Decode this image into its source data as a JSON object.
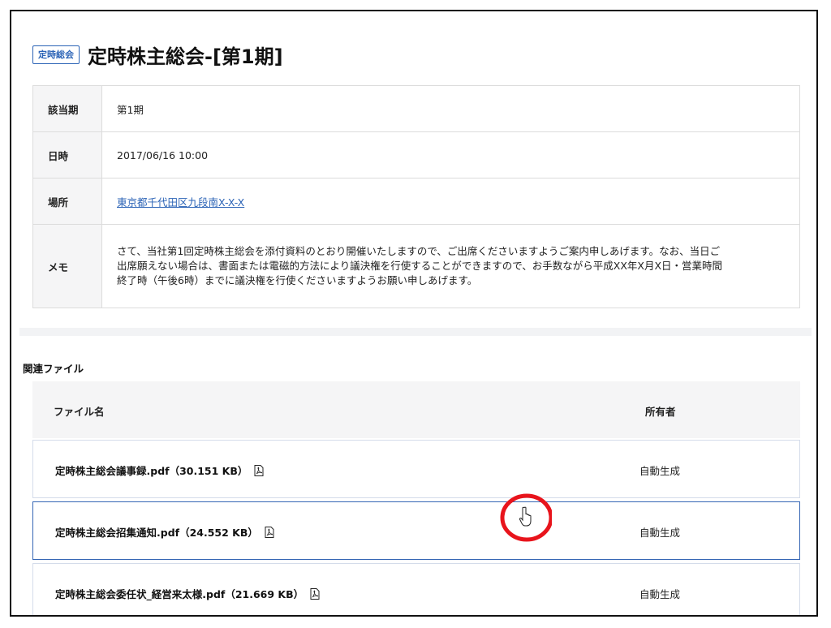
{
  "header": {
    "badge": "定時総会",
    "title": "定時株主総会-[第1期]"
  },
  "details": [
    {
      "label": "該当期",
      "value": "第1期"
    },
    {
      "label": "日時",
      "value": "2017/06/16 10:00"
    },
    {
      "label": "場所",
      "value": "東京都千代田区九段南X-X-X"
    }
  ],
  "memo": {
    "label": "メモ",
    "lines": [
      "さて、当社第1回定時株主総会を添付資料のとおり開催いたしますので、ご出席くださいますようご案内申しあげます。なお、当日ご",
      "出席願えない場合は、書面または電磁的方法により議決権を行使することができますので、お手数ながら平成XX年X月X日・営業時間",
      "終了時（午後6時）までに議決権を行使くださいますようお願い申しあげます。"
    ]
  },
  "files": {
    "heading": "関連ファイル",
    "col_name": "ファイル名",
    "col_owner": "所有者",
    "rows": [
      {
        "name": "定時株主総会議事録.pdf（30.151 KB）",
        "owner": "自動生成"
      },
      {
        "name": "定時株主総会招集通知.pdf（24.552 KB）",
        "owner": "自動生成"
      },
      {
        "name": "定時株主総会委任状_経営来太様.pdf（21.669 KB）",
        "owner": "自動生成"
      }
    ]
  },
  "icons": {
    "file": "pdf-file-icon",
    "cursor": "hand-pointer-icon"
  },
  "colors": {
    "accent": "#2b63b6",
    "highlight_circle": "#e8141c"
  }
}
